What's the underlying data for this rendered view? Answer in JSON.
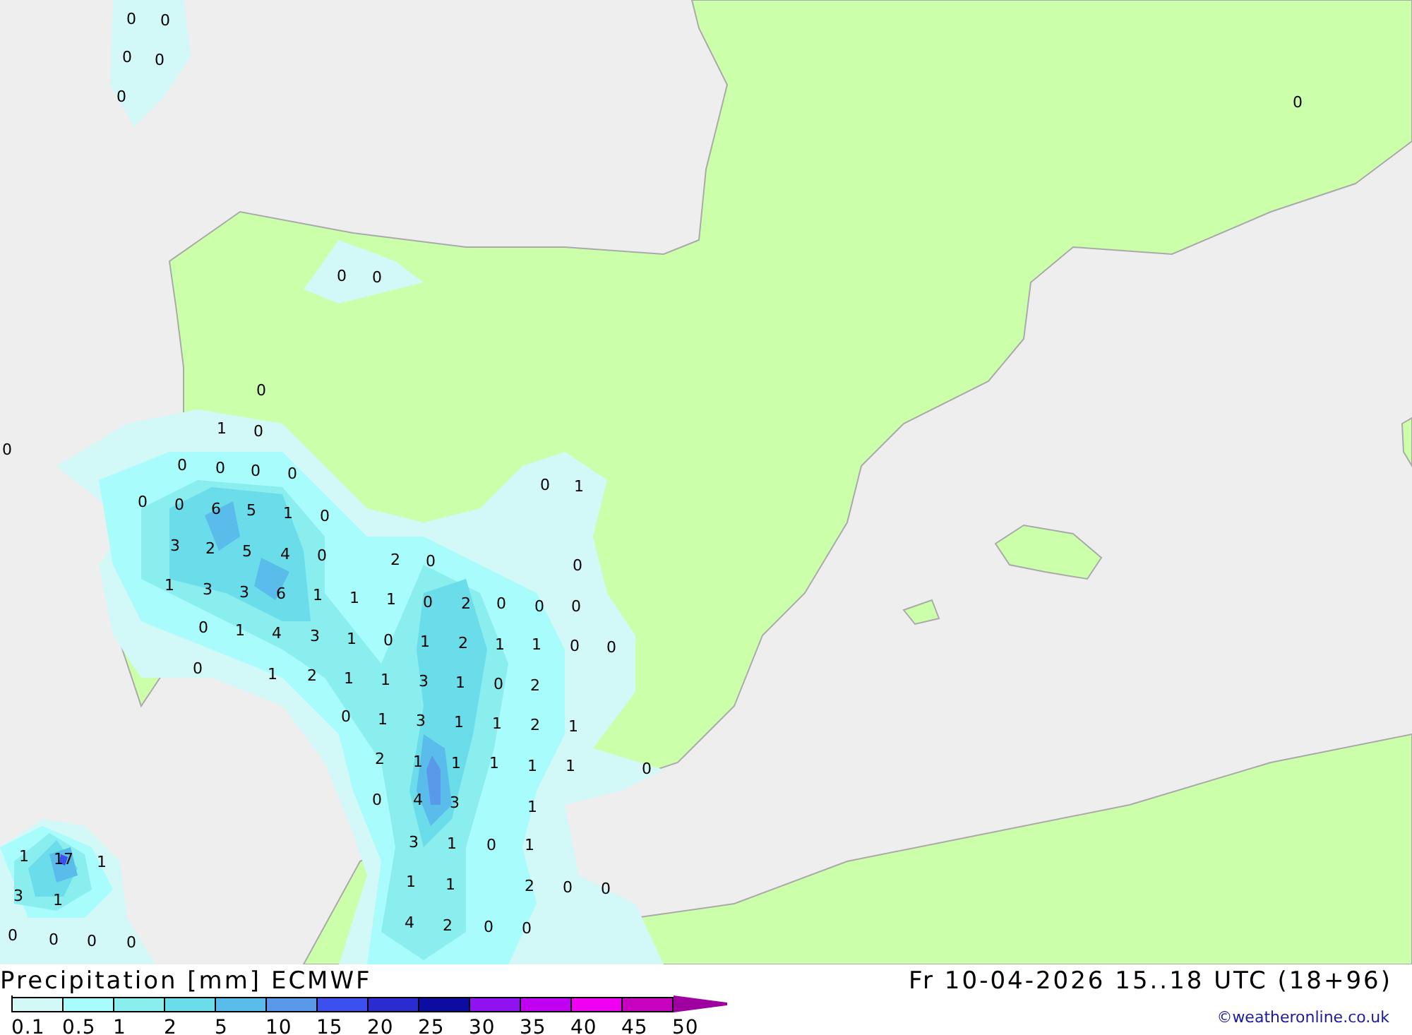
{
  "map": {
    "labels": [
      {
        "value": "0"
      },
      {
        "value": "0"
      },
      {
        "value": "0"
      },
      {
        "value": "0"
      },
      {
        "value": "0"
      },
      {
        "value": "0"
      },
      {
        "value": "0"
      },
      {
        "value": "0"
      },
      {
        "value": "0"
      },
      {
        "value": "0"
      },
      {
        "value": "1"
      },
      {
        "value": "0"
      },
      {
        "value": "0"
      },
      {
        "value": "0"
      },
      {
        "value": "0"
      },
      {
        "value": "0"
      },
      {
        "value": "0"
      },
      {
        "value": "0"
      },
      {
        "value": "6"
      },
      {
        "value": "5"
      },
      {
        "value": "1"
      },
      {
        "value": "0"
      },
      {
        "value": "0"
      },
      {
        "value": "1"
      },
      {
        "value": "3"
      },
      {
        "value": "2"
      },
      {
        "value": "5"
      },
      {
        "value": "4"
      },
      {
        "value": "0"
      },
      {
        "value": "2"
      },
      {
        "value": "0"
      },
      {
        "value": "0"
      },
      {
        "value": "1"
      },
      {
        "value": "3"
      },
      {
        "value": "3"
      },
      {
        "value": "6"
      },
      {
        "value": "1"
      },
      {
        "value": "1"
      },
      {
        "value": "1"
      },
      {
        "value": "0"
      },
      {
        "value": "2"
      },
      {
        "value": "0"
      },
      {
        "value": "0"
      },
      {
        "value": "0"
      },
      {
        "value": "0"
      },
      {
        "value": "1"
      },
      {
        "value": "4"
      },
      {
        "value": "3"
      },
      {
        "value": "1"
      },
      {
        "value": "0"
      },
      {
        "value": "1"
      },
      {
        "value": "2"
      },
      {
        "value": "1"
      },
      {
        "value": "1"
      },
      {
        "value": "0"
      },
      {
        "value": "0"
      },
      {
        "value": "0"
      },
      {
        "value": "1"
      },
      {
        "value": "2"
      },
      {
        "value": "1"
      },
      {
        "value": "1"
      },
      {
        "value": "3"
      },
      {
        "value": "1"
      },
      {
        "value": "0"
      },
      {
        "value": "2"
      },
      {
        "value": "0"
      },
      {
        "value": "1"
      },
      {
        "value": "3"
      },
      {
        "value": "1"
      },
      {
        "value": "1"
      },
      {
        "value": "2"
      },
      {
        "value": "1"
      },
      {
        "value": "2"
      },
      {
        "value": "1"
      },
      {
        "value": "1"
      },
      {
        "value": "1"
      },
      {
        "value": "1"
      },
      {
        "value": "1"
      },
      {
        "value": "0"
      },
      {
        "value": "0"
      },
      {
        "value": "4"
      },
      {
        "value": "3"
      },
      {
        "value": "1"
      },
      {
        "value": "3"
      },
      {
        "value": "1"
      },
      {
        "value": "0"
      },
      {
        "value": "1"
      },
      {
        "value": "1"
      },
      {
        "value": "17"
      },
      {
        "value": "1"
      },
      {
        "value": "3"
      },
      {
        "value": "1"
      },
      {
        "value": "1"
      },
      {
        "value": "1"
      },
      {
        "value": "2"
      },
      {
        "value": "0"
      },
      {
        "value": "0"
      },
      {
        "value": "0"
      },
      {
        "value": "0"
      },
      {
        "value": "0"
      },
      {
        "value": "0"
      },
      {
        "value": "4"
      },
      {
        "value": "2"
      },
      {
        "value": "0"
      },
      {
        "value": "0"
      }
    ]
  },
  "legend": {
    "title": "Precipitation [mm] ECMWF",
    "validity": "Fr 10-04-2026 15..18 UTC (18+96)",
    "bands": [
      {
        "color": "#d2f8f8"
      },
      {
        "color": "#a8fcfc"
      },
      {
        "color": "#8aeeee"
      },
      {
        "color": "#6adcea"
      },
      {
        "color": "#5abcea"
      },
      {
        "color": "#5a98ea"
      },
      {
        "color": "#3c50f0"
      },
      {
        "color": "#2a2cd0"
      },
      {
        "color": "#0c0ca0"
      },
      {
        "color": "#9012f0"
      },
      {
        "color": "#c000f0"
      },
      {
        "color": "#f000f0"
      },
      {
        "color": "#c800c0"
      }
    ],
    "overflow_arrow": {
      "color": "#a000a0"
    },
    "scale_labels": [
      "0.1",
      "0.5",
      "1",
      "2",
      "5",
      "10",
      "15",
      "20",
      "25",
      "30",
      "35",
      "40",
      "45",
      "50"
    ],
    "credit": "©weatheronline.co.uk"
  }
}
